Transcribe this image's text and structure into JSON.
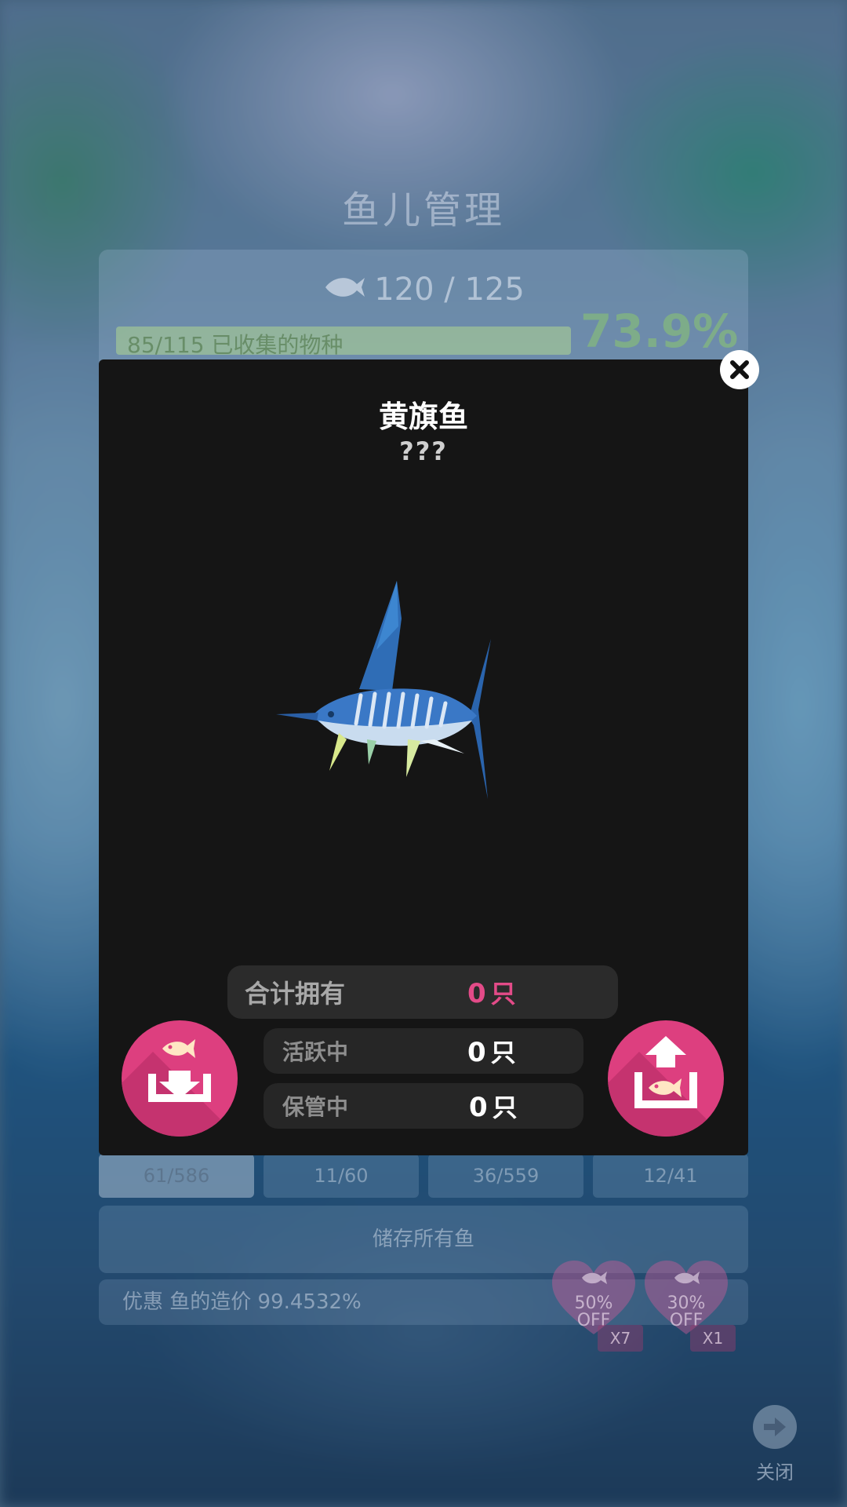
{
  "background_screen": {
    "title": "鱼儿管理",
    "fish_count": "120 / 125",
    "collection_progress_text": "85/115 已收集的物种",
    "collection_percent": "73.9%",
    "tabs": [
      "61/586",
      "11/60",
      "36/559",
      "12/41"
    ],
    "store_all_label": "储存所有鱼",
    "discount_text": "优惠 鱼的造价 99.4532%",
    "coupons": [
      {
        "text": "50%\nOFF",
        "line1": "50%",
        "line2": "OFF",
        "qty": "X7"
      },
      {
        "text": "30%\nOFF",
        "line1": "30%",
        "line2": "OFF",
        "qty": "X1"
      }
    ],
    "close_label": "关闭"
  },
  "modal": {
    "fish_name": "黄旗鱼",
    "fish_subtitle": "???",
    "stats": {
      "total_label": "合计拥有",
      "total_value": "0",
      "active_label": "活跃中",
      "active_value": "0",
      "stored_label": "保管中",
      "stored_value": "0",
      "unit": "只"
    }
  },
  "colors": {
    "accent_pink": "#dd3f7f",
    "total_value_color": "#e34b88",
    "modal_bg": "#151515"
  },
  "icons": {
    "modal_close": "close-icon",
    "store_button": "fish-store-icon",
    "release_button": "fish-release-icon",
    "bg_close": "arrow-right-icon"
  }
}
